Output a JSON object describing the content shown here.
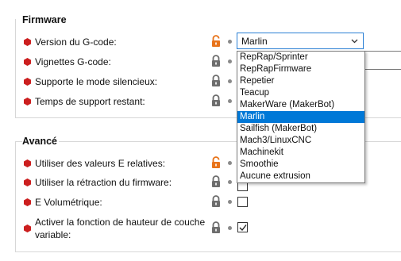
{
  "firmware": {
    "title": "Firmware",
    "gcode_flavor": {
      "label": "Version du G-code:",
      "selected": "Marlin",
      "options": [
        "RepRap/Sprinter",
        "RepRapFirmware",
        "Repetier",
        "Teacup",
        "MakerWare (MakerBot)",
        "Marlin",
        "Sailfish (MakerBot)",
        "Mach3/LinuxCNC",
        "Machinekit",
        "Smoothie",
        "Aucune extrusion"
      ]
    },
    "rows": [
      {
        "label": "Vignettes G-code:"
      },
      {
        "label": "Supporte le mode silencieux:"
      },
      {
        "label": "Temps de support restant:"
      }
    ]
  },
  "advanced": {
    "title": "Avancé",
    "rows": [
      {
        "label": "Utiliser des valeurs E relatives:",
        "checked": false
      },
      {
        "label": "Utiliser la rétraction du firmware:",
        "checked": false
      },
      {
        "label": "E Volumétrique:",
        "checked": false
      },
      {
        "label": "Activer la fonction de hauteur de couche variable:",
        "checked": true
      }
    ]
  },
  "colors": {
    "required_marker": "#cc1f1f",
    "unlocked": "#e8731a",
    "locked": "#6d6d6d",
    "selection": "#0078d7"
  }
}
